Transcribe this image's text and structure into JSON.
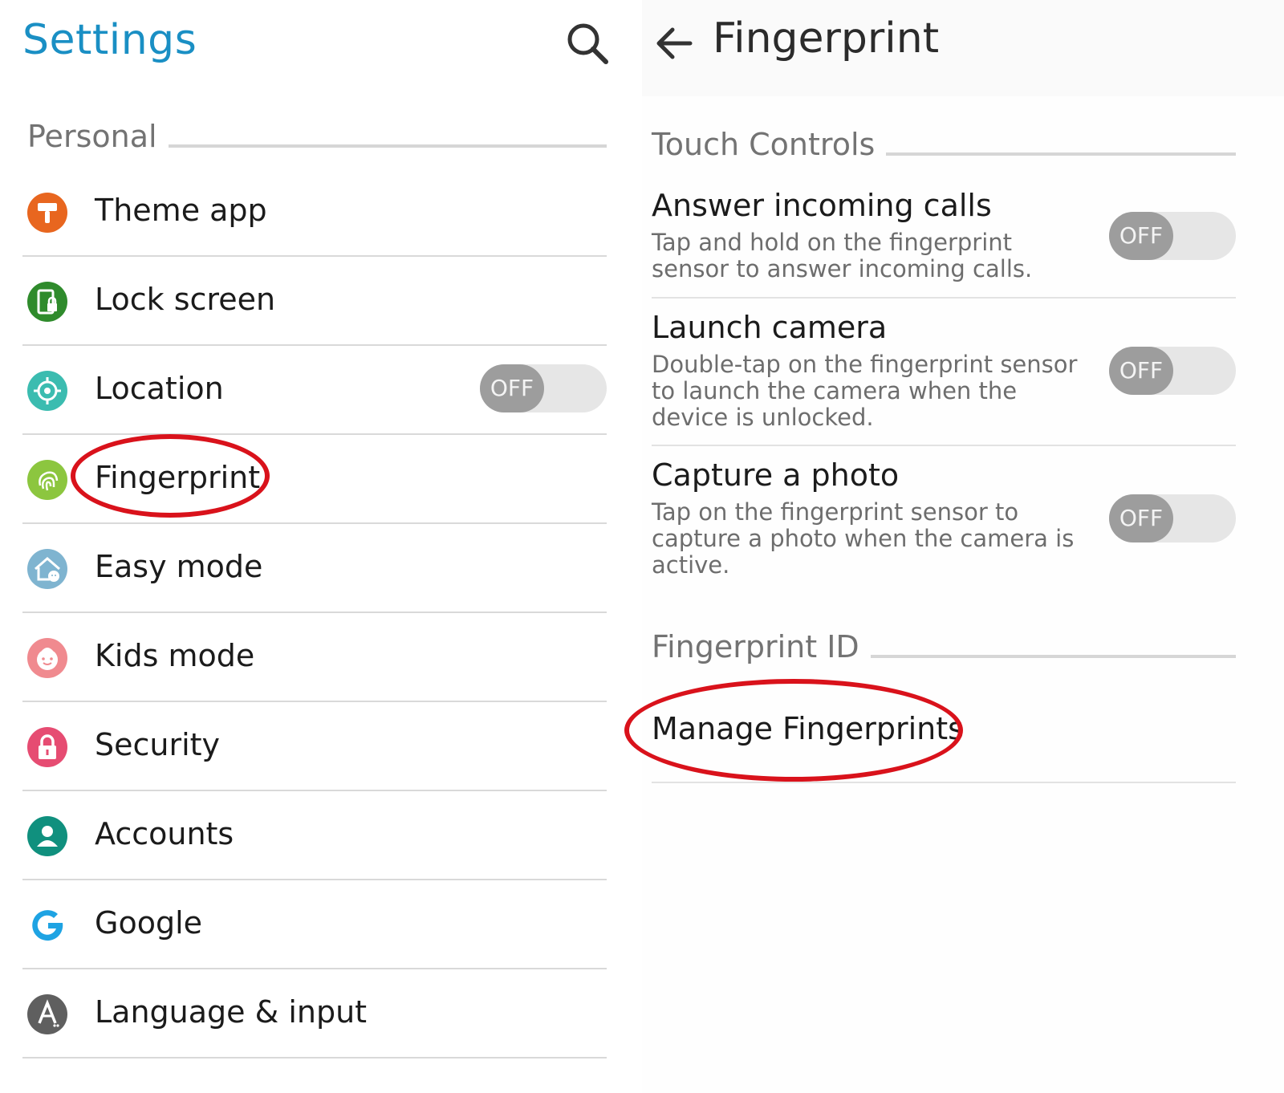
{
  "settings": {
    "title": "Settings",
    "search_icon": "search-icon",
    "section_personal": "Personal",
    "items": [
      {
        "label": "Theme app",
        "icon": "paint-roller-icon",
        "color": "#e8661f"
      },
      {
        "label": "Lock screen",
        "icon": "lock-screen-icon",
        "color": "#2f8b2c"
      },
      {
        "label": "Location",
        "icon": "location-crosshair-icon",
        "color": "#3bbcb0",
        "toggle": "OFF"
      },
      {
        "label": "Fingerprint",
        "icon": "fingerprint-icon",
        "color": "#8cc63f"
      },
      {
        "label": "Easy mode",
        "icon": "easy-mode-house-icon",
        "color": "#7fb4d0"
      },
      {
        "label": "Kids mode",
        "icon": "kids-face-icon",
        "color": "#f08a8f"
      },
      {
        "label": "Security",
        "icon": "padlock-icon",
        "color": "#e64c72"
      },
      {
        "label": "Accounts",
        "icon": "person-icon",
        "color": "#10907e"
      },
      {
        "label": "Google",
        "icon": "google-g-icon",
        "color": "#1ea3e3"
      },
      {
        "label": "Language & input",
        "icon": "language-a-icon",
        "color": "#5f5f5f"
      }
    ]
  },
  "fingerprint": {
    "title": "Fingerprint",
    "back_icon": "back-arrow-icon",
    "section_touch": "Touch Controls",
    "options": [
      {
        "title": "Answer incoming calls",
        "desc": "Tap and hold on the fingerprint sensor to answer incoming calls.",
        "toggle": "OFF"
      },
      {
        "title": "Launch camera",
        "desc": "Double-tap on the fingerprint sensor to launch the camera when the device is unlocked.",
        "toggle": "OFF"
      },
      {
        "title": "Capture a photo",
        "desc": "Tap on the fingerprint sensor to capture a photo when the camera is active.",
        "toggle": "OFF"
      }
    ],
    "section_id": "Fingerprint ID",
    "manage_label": "Manage Fingerprints"
  },
  "colors": {
    "accent": "#1a8fc4",
    "highlight": "#d9121b",
    "toggle_knob": "#9d9d9d",
    "toggle_track": "#e6e6e6"
  }
}
